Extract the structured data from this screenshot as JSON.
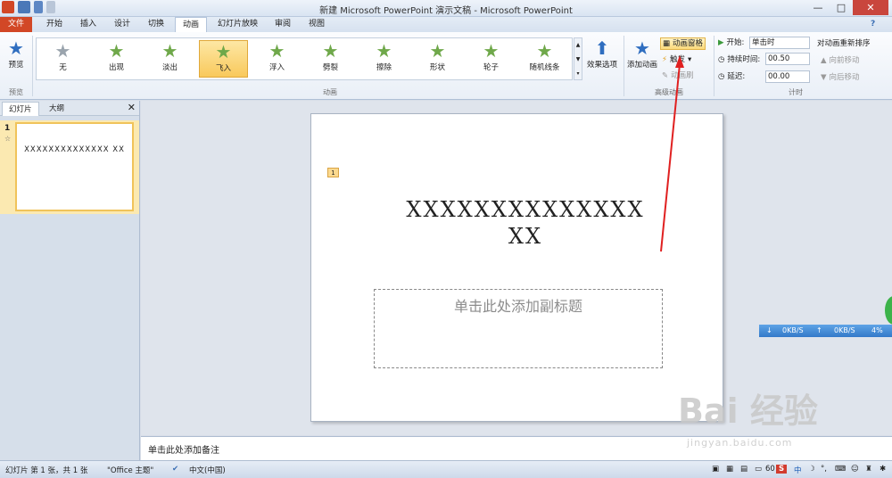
{
  "window": {
    "title": "新建 Microsoft PowerPoint 演示文稿 - Microsoft PowerPoint",
    "minimize": "—",
    "maximize": "□",
    "close": "✕"
  },
  "tabs": [
    {
      "label": "文件"
    },
    {
      "label": "开始"
    },
    {
      "label": "插入"
    },
    {
      "label": "设计"
    },
    {
      "label": "切换"
    },
    {
      "label": "动画"
    },
    {
      "label": "幻灯片放映"
    },
    {
      "label": "审阅"
    },
    {
      "label": "视图"
    }
  ],
  "ribbon": {
    "preview": {
      "label": "预览",
      "group": "预览"
    },
    "animations": [
      {
        "label": "无",
        "selected": false,
        "icon": "star-outline-icon"
      },
      {
        "label": "出现",
        "selected": false,
        "icon": "star-icon"
      },
      {
        "label": "淡出",
        "selected": false,
        "icon": "star-icon"
      },
      {
        "label": "飞入",
        "selected": true,
        "icon": "star-icon"
      },
      {
        "label": "浮入",
        "selected": false,
        "icon": "star-icon"
      },
      {
        "label": "劈裂",
        "selected": false,
        "icon": "star-icon"
      },
      {
        "label": "擦除",
        "selected": false,
        "icon": "star-icon"
      },
      {
        "label": "形状",
        "selected": false,
        "icon": "star-icon"
      },
      {
        "label": "轮子",
        "selected": false,
        "icon": "star-icon"
      },
      {
        "label": "随机线条",
        "selected": false,
        "icon": "star-icon"
      }
    ],
    "effect_options": "效果选项",
    "animation_group": "动画",
    "add_animation": "添加动画",
    "animation_pane": "动画窗格",
    "trigger": "触发",
    "animation_painter": "动画刷",
    "advanced_group": "高级动画",
    "start_label": "开始:",
    "start_value": "单击时",
    "duration_label": "持续时间:",
    "duration_value": "00.50",
    "delay_label": "延迟:",
    "delay_value": "00.00",
    "reorder_label": "对动画重新排序",
    "move_earlier": "向前移动",
    "move_later": "向后移动",
    "timing_group": "计时",
    "help": "?"
  },
  "left_pane": {
    "tabs": [
      {
        "label": "幻灯片"
      },
      {
        "label": "大纲"
      }
    ],
    "close": "✕",
    "slide_number": "1",
    "thumb_text": "XXXXXXXXXXXXXX XX"
  },
  "slide": {
    "anim_tag": "1",
    "title_line1": "XXXXXXXXXXXXXX",
    "title_line2": "XX",
    "subtitle_placeholder": "单击此处添加副标题"
  },
  "notes_placeholder": "单击此处添加备注",
  "status": {
    "slide_info": "幻灯片 第 1 张，共 1 张",
    "theme": "\"Office 主题\"",
    "language": "中文(中国)",
    "zoom": "60"
  },
  "netbar": {
    "down": "0KB/S",
    "up": "0KB/S",
    "percent": "4%"
  },
  "watermark": {
    "brand": "Bai  经验",
    "url": "jingyan.baidu.com"
  },
  "colors": {
    "file_tab": "#d24726",
    "accent_star": "#6fa84a",
    "highlight": "#f9c95c",
    "annotation_arrow": "#e02020"
  }
}
